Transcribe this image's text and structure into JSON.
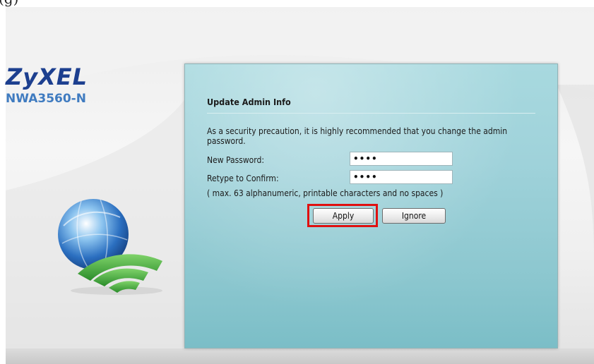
{
  "brand": {
    "logo": "ZyXEL",
    "model": "NWA3560-N"
  },
  "top_fragment": "(g)",
  "dialog": {
    "title": "Update Admin Info",
    "description": "As a security precaution, it is highly recommended that you change the admin password.",
    "fields": [
      {
        "label": "New Password:",
        "value": "••••"
      },
      {
        "label": "Retype to Confirm:",
        "value": "••••"
      }
    ],
    "hint": "( max. 63 alphanumeric, printable characters and no spaces )",
    "apply_label": "Apply",
    "ignore_label": "Ignore"
  },
  "colors": {
    "panel": "#9fd2da",
    "brand_logo": "#1c3f8f",
    "brand_model": "#3f7bc0",
    "highlight": "#e01010",
    "wifi_green": "#3aa63a"
  },
  "icons": [
    "globe-icon",
    "wifi-signal-icon"
  ]
}
